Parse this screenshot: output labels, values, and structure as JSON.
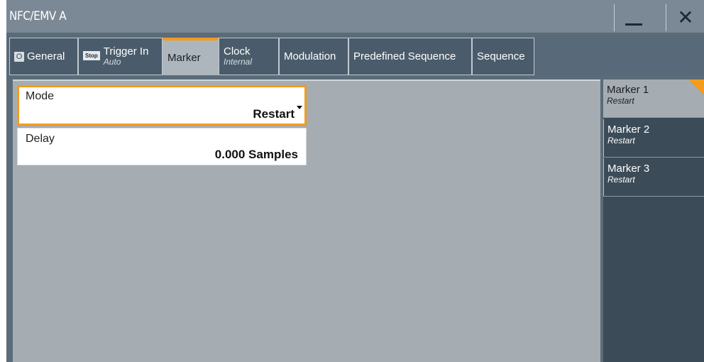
{
  "window": {
    "title": "NFC/EMV A",
    "minimize_icon": "minimize-icon",
    "close_icon": "close-icon",
    "close_glyph": "✕"
  },
  "tabs": [
    {
      "label": "General",
      "badge": "O"
    },
    {
      "label": "Trigger In",
      "sub": "Auto",
      "badge": "Stop"
    },
    {
      "label": "Marker",
      "active": true
    },
    {
      "label": "Clock",
      "sub": "Internal"
    },
    {
      "label": "Modulation"
    },
    {
      "label": "Predefined Sequence"
    },
    {
      "label": "Sequence"
    }
  ],
  "marker_panel": {
    "mode": {
      "label": "Mode",
      "value": "Restart"
    },
    "delay": {
      "label": "Delay",
      "value": "0.000  Samples"
    }
  },
  "markers": [
    {
      "name": "Marker 1",
      "mode": "Restart",
      "active": true
    },
    {
      "name": "Marker 2",
      "mode": "Restart"
    },
    {
      "name": "Marker 3",
      "mode": "Restart"
    }
  ],
  "colors": {
    "accent": "#f39c1b",
    "titlebar": "#7b8895",
    "tab_bg": "#4a5c6b",
    "content_bg": "#a5acb2",
    "side_bg": "#3b4b57"
  }
}
